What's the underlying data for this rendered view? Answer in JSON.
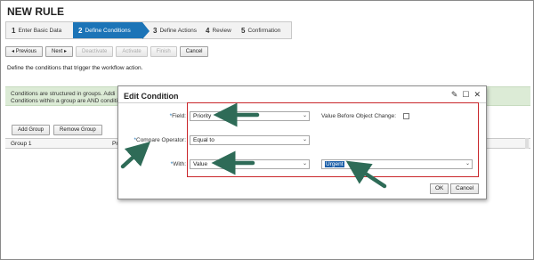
{
  "page": {
    "title": "NEW RULE"
  },
  "roadmap": {
    "steps": [
      {
        "num": "1",
        "label": "Enter Basic Data"
      },
      {
        "num": "2",
        "label": "Define Conditions"
      },
      {
        "num": "3",
        "label": "Define Actions"
      },
      {
        "num": "4",
        "label": "Review"
      },
      {
        "num": "5",
        "label": "Confirmation"
      }
    ]
  },
  "toolbar": {
    "previous": "◂ Previous",
    "next": "Next ▸",
    "deactivate": "Deactivate",
    "activate": "Activate",
    "finish": "Finish",
    "cancel": "Cancel"
  },
  "instruction": "Define the conditions that trigger the workflow action.",
  "info": {
    "line1": "Conditions are structured in groups. Addi",
    "line2": "Conditions within a group are AND conditi"
  },
  "groups": {
    "add_group": "Add Group",
    "remove_group": "Remove Group",
    "header_col1": "Group  1",
    "header_col2": "Pri"
  },
  "dialog": {
    "title": "Edit Condition",
    "field_label": "Field:",
    "field_value": "Priority",
    "value_before_label": "Value Before Object Change:",
    "compare_label": "Compare Operator:",
    "compare_value": "Equal to",
    "with_label": "With:",
    "with_value": "Value",
    "value_input": "Urgent",
    "ok": "OK",
    "cancel": "Cancel"
  },
  "colors": {
    "accent": "#1c74b7",
    "highlight_box": "#c9262b",
    "annotation_arrow": "#2e6b57",
    "info_bg": "#dcebd6"
  }
}
